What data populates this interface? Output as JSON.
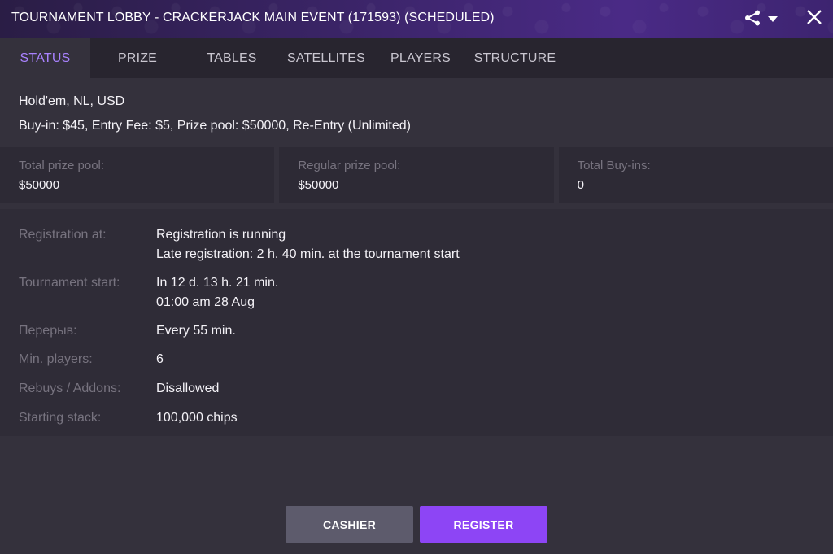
{
  "window": {
    "title": "TOURNAMENT LOBBY - CRACKERJACK MAIN EVENT (171593) (SCHEDULED)"
  },
  "tabs": [
    {
      "label": "STATUS",
      "active": true
    },
    {
      "label": "PRIZE",
      "active": false
    },
    {
      "label": "TABLES",
      "active": false
    },
    {
      "label": "SATELLITES",
      "active": false
    },
    {
      "label": "PLAYERS",
      "active": false
    },
    {
      "label": "STRUCTURE",
      "active": false
    }
  ],
  "summary": {
    "game": "Hold'em, NL, USD",
    "buyin": "Buy-in: $45, Entry Fee: $5, Prize pool: $50000, Re-Entry (Unlimited)"
  },
  "stats": [
    {
      "label": "Total prize pool:",
      "value": "$50000"
    },
    {
      "label": "Regular prize pool:",
      "value": "$50000"
    },
    {
      "label": "Total Buy-ins:",
      "value": "0"
    }
  ],
  "details": {
    "registration": {
      "label": "Registration at:",
      "line1": "Registration is running",
      "line2": "Late registration: 2 h. 40 min. at the tournament start"
    },
    "start": {
      "label": "Tournament start:",
      "line1": "In 12 d. 13 h. 21 min.",
      "line2": "01:00 am 28 Aug"
    },
    "break": {
      "label": "Перерыв:",
      "value": "Every 55 min."
    },
    "min_players": {
      "label": "Min. players:",
      "value": "6"
    },
    "rebuys": {
      "label": "Rebuys / Addons:",
      "value": "Disallowed"
    },
    "stack": {
      "label": "Starting stack:",
      "value": "100,000 chips"
    }
  },
  "buttons": {
    "cashier": "CASHIER",
    "register": "REGISTER"
  },
  "icons": {
    "share": "share-icon",
    "dropdown": "caret-down-icon",
    "close": "close-icon"
  },
  "colors": {
    "accent": "#a982ff",
    "register": "#8d45f5",
    "cashier": "#5d5b6c"
  }
}
